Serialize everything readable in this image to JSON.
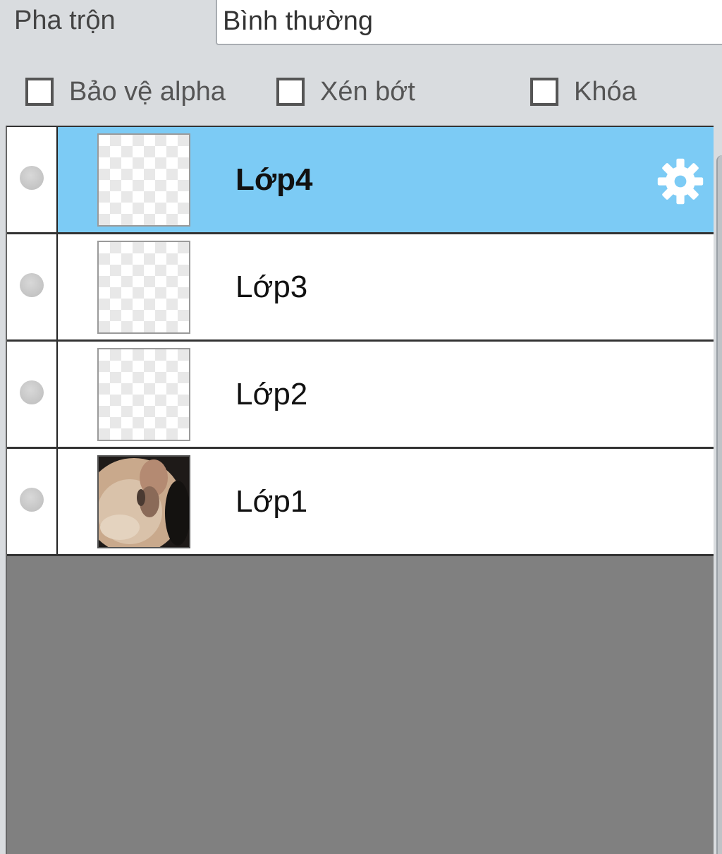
{
  "blend": {
    "label": "Pha trộn",
    "value": "Bình thường"
  },
  "options": {
    "protect_alpha": {
      "label": "Bảo vệ alpha",
      "checked": false
    },
    "clip": {
      "label": "Xén bớt",
      "checked": false
    },
    "lock": {
      "label": "Khóa",
      "checked": false
    }
  },
  "layers": [
    {
      "name": "Lớp4",
      "selected": true,
      "thumbnail": "transparent"
    },
    {
      "name": "Lớp3",
      "selected": false,
      "thumbnail": "transparent"
    },
    {
      "name": "Lớp2",
      "selected": false,
      "thumbnail": "transparent"
    },
    {
      "name": "Lớp1",
      "selected": false,
      "thumbnail": "photo"
    }
  ],
  "icons": {
    "layer_settings": "gear-icon",
    "visibility": "visibility-dot-icon"
  },
  "colors": {
    "selected_row": "#7ccbf5",
    "panel_bg": "#d9dcdf",
    "empty_area": "#808080"
  }
}
